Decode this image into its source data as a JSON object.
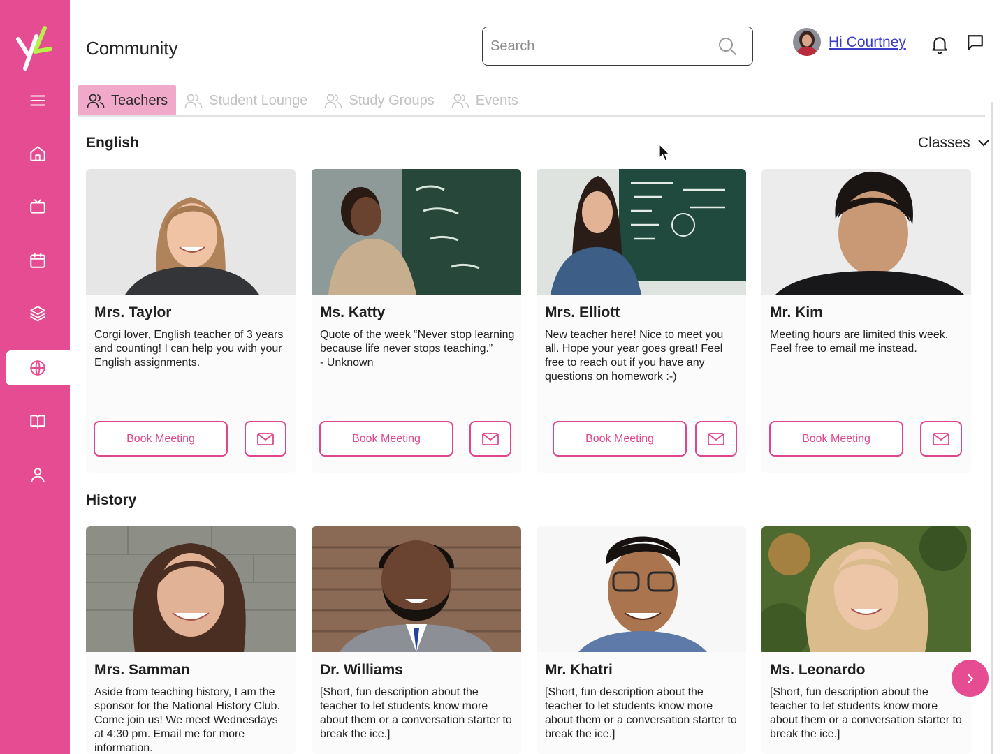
{
  "sidebar": {
    "logo": "yL",
    "items": [
      {
        "icon": "menu-icon"
      },
      {
        "icon": "home-icon"
      },
      {
        "icon": "tv-icon"
      },
      {
        "icon": "calendar-icon"
      },
      {
        "icon": "layers-icon"
      },
      {
        "icon": "globe-icon",
        "active": true
      },
      {
        "icon": "book-icon"
      },
      {
        "icon": "user-icon"
      }
    ]
  },
  "header": {
    "title": "Community",
    "search_placeholder": "Search",
    "greeting": "Hi Courtney"
  },
  "tabs": [
    {
      "label": "Teachers",
      "active": true
    },
    {
      "label": "Student Lounge"
    },
    {
      "label": "Study Groups"
    },
    {
      "label": "Events"
    }
  ],
  "filter": {
    "label": "Classes"
  },
  "sections": [
    {
      "title": "English",
      "teachers": [
        {
          "name": "Mrs. Taylor",
          "desc": "Corgi lover, English teacher of 3 years and counting! I can help you with your English assignments.",
          "book_label": "Book Meeting"
        },
        {
          "name": "Ms. Katty",
          "desc": "Quote of the week “Never stop learning because life never stops teaching.”\n- Unknown",
          "book_label": "Book Meeting"
        },
        {
          "name": "Mrs. Elliott",
          "desc": "New teacher here! Nice to meet you all. Hope your year goes great! Feel free to reach out if you have any questions on homework :-)",
          "book_label": "Book Meeting"
        },
        {
          "name": "Mr. Kim",
          "desc": "Meeting hours are limited this week. Feel free to email me instead.",
          "book_label": "Book Meeting"
        }
      ]
    },
    {
      "title": "History",
      "teachers": [
        {
          "name": "Mrs. Samman",
          "desc": "Aside from teaching history, I am the sponsor for the National History Club. Come join us! We meet Wednesdays at 4:30 pm. Email me for more information."
        },
        {
          "name": "Dr. Williams",
          "desc": "[Short, fun description about the teacher to let students know more about them or a conversation starter to break the ice.]"
        },
        {
          "name": "Mr. Khatri",
          "desc": "[Short, fun description about the teacher to let students know more about them or a conversation starter to break the ice.]"
        },
        {
          "name": "Ms. Leonardo",
          "desc": "[Short, fun description about the teacher to let students know more about them or a conversation starter to break the ice.]"
        }
      ]
    }
  ],
  "colors": {
    "brand": "#e54c91",
    "tab_active": "#f0a9c9",
    "link": "#3b3bc6"
  }
}
